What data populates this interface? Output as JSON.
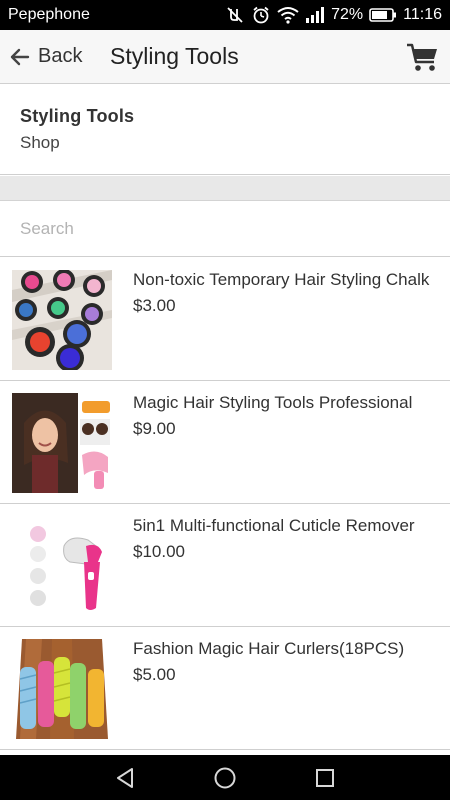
{
  "status_bar": {
    "carrier": "Pepephone",
    "battery": "72%",
    "time": "11:16",
    "icons": [
      "mute-icon",
      "alarm-icon",
      "wifi-icon",
      "signal-icon",
      "battery-icon"
    ]
  },
  "app_bar": {
    "back_label": "Back",
    "title": "Styling Tools",
    "cart_icon": "cart-icon"
  },
  "page_header": {
    "title": "Styling Tools",
    "subtitle": "Shop"
  },
  "search": {
    "placeholder": "Search",
    "value": ""
  },
  "products": [
    {
      "name": "Non-toxic Temporary Hair Styling Chalk",
      "price": "$3.00"
    },
    {
      "name": "Magic Hair Styling Tools Professional",
      "price": "$9.00"
    },
    {
      "name": "5in1 Multi-functional Cuticle Remover",
      "price": "$10.00"
    },
    {
      "name": "Fashion Magic Hair Curlers(18PCS)",
      "price": "$5.00"
    }
  ],
  "nav_bar": {
    "buttons": [
      "back-triangle-icon",
      "home-circle-icon",
      "recents-square-icon"
    ]
  },
  "colors": {
    "app_bar_bg": "#f7f7f7",
    "divider": "#cfcfcf",
    "strip": "#e8e8e8",
    "text": "#333333"
  }
}
